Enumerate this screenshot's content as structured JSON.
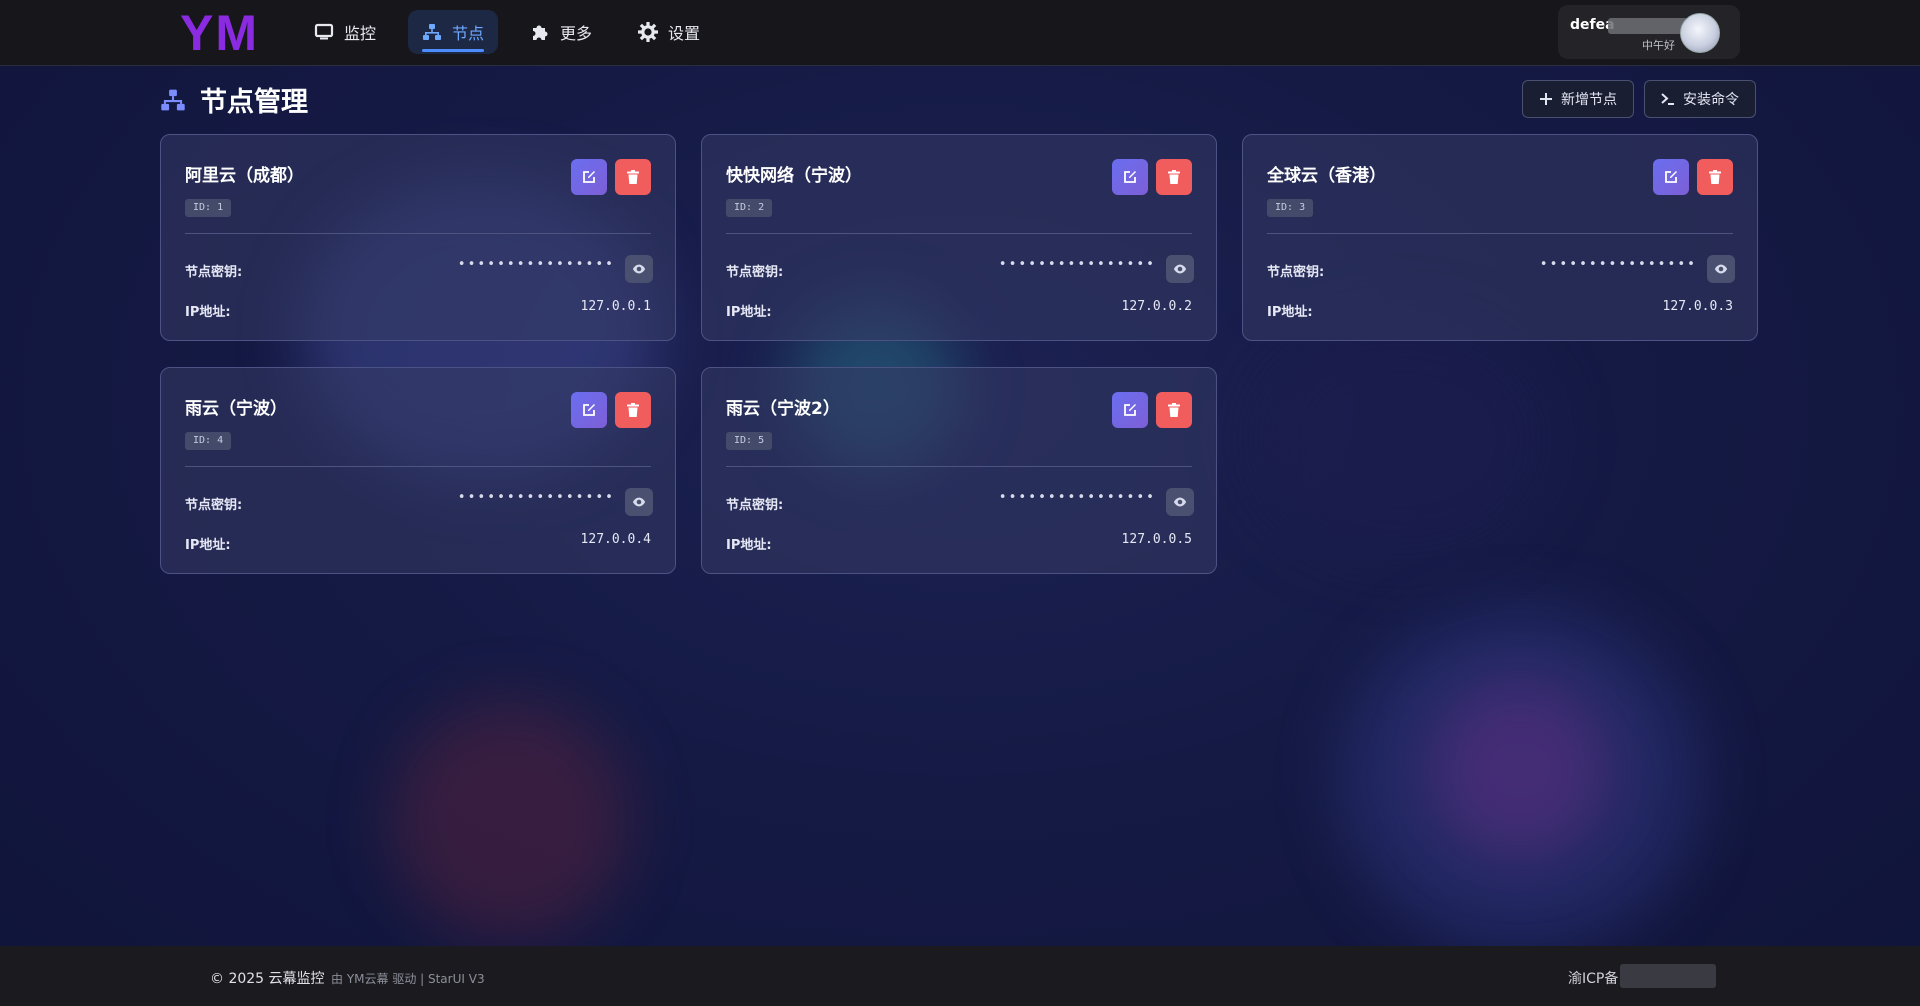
{
  "header": {
    "logo": "YM",
    "nav": [
      {
        "label": "监控",
        "icon": "monitor-icon",
        "active": false
      },
      {
        "label": "节点",
        "icon": "network-icon",
        "active": true
      },
      {
        "label": "更多",
        "icon": "puzzle-icon",
        "active": false
      },
      {
        "label": "设置",
        "icon": "gear-icon",
        "active": false
      }
    ],
    "user": {
      "name": "defea",
      "greeting": "中午好"
    }
  },
  "page": {
    "title": "节点管理",
    "add_button": "新增节点",
    "install_button": "安装命令"
  },
  "labels": {
    "key": "节点密钥:",
    "ip": "IP地址:",
    "masked_key": "••••••••••••••••"
  },
  "nodes": [
    {
      "name": "阿里云（成都）",
      "id": "ID: 1",
      "ip": "127.0.0.1"
    },
    {
      "name": "快快网络（宁波）",
      "id": "ID: 2",
      "ip": "127.0.0.2"
    },
    {
      "name": "全球云（香港）",
      "id": "ID: 3",
      "ip": "127.0.0.3"
    },
    {
      "name": "雨云（宁波）",
      "id": "ID: 4",
      "ip": "127.0.0.4"
    },
    {
      "name": "雨云（宁波2）",
      "id": "ID: 5",
      "ip": "127.0.0.5"
    }
  ],
  "footer": {
    "copyright": "© 2025 云幕监控",
    "powered": "由 YM云幕 驱动 | StarUI V3",
    "icp": "渝ICP备"
  },
  "colors": {
    "logo": "#8a2be2",
    "accent": "#4c8dff",
    "edit": "#6a6ef0",
    "delete": "#f15d5d"
  }
}
